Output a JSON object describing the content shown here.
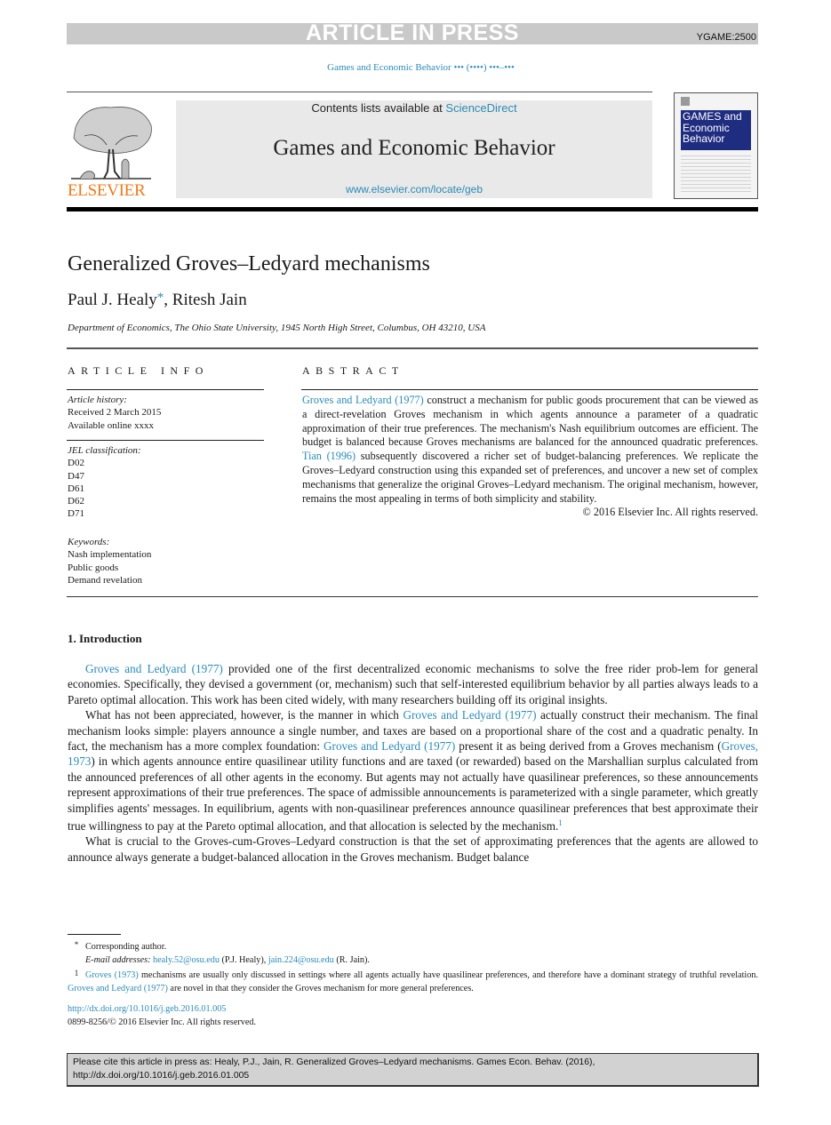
{
  "press_banner": {
    "label": "ARTICLE IN PRESS",
    "code": "YGAME:2500"
  },
  "journal_ref": "Games and Economic Behavior ••• (••••) •••–•••",
  "header": {
    "publisher_logo": "ELSEVIER",
    "contents_prefix": "Contents lists available at ",
    "contents_link": "ScienceDirect",
    "journal_name": "Games and Economic Behavior",
    "journal_url": "www.elsevier.com/locate/geb",
    "cover_title_lines": [
      "GAMES and",
      "Economic",
      "Behavior"
    ]
  },
  "article": {
    "title": "Generalized Groves–Ledyard mechanisms",
    "author1": "Paul J. Healy",
    "author_marker": "*",
    "author_sep": ", ",
    "author2": "Ritesh Jain",
    "affiliation": "Department of Economics, The Ohio State University, 1945 North High Street, Columbus, OH 43210, USA"
  },
  "article_info": {
    "heading": "ARTICLE INFO",
    "history_label": "Article history:",
    "received": "Received 2 March 2015",
    "available": "Available online xxxx",
    "jel_label": "JEL classification:",
    "jel_codes": [
      "D02",
      "D47",
      "D61",
      "D62",
      "D71"
    ],
    "keywords_label": "Keywords:",
    "keywords": [
      "Nash implementation",
      "Public goods",
      "Demand revelation"
    ]
  },
  "abstract": {
    "heading": "ABSTRACT",
    "link1": "Groves and Ledyard (1977)",
    "text1": " construct a mechanism for public goods procurement that can be viewed as a direct-revelation Groves mechanism in which agents announce a parameter of a quadratic approximation of their true preferences. The mechanism's Nash equilibrium outcomes are efficient. The budget is balanced because Groves mechanisms are balanced for the announced quadratic preferences. ",
    "link2": "Tian (1996)",
    "text2": " subsequently discovered a richer set of budget-balancing preferences. We replicate the Groves–Ledyard construction using this expanded set of preferences, and uncover a new set of complex mechanisms that generalize the original Groves–Ledyard mechanism. The original mechanism, however, remains the most appealing in terms of both simplicity and stability.",
    "copyright": "© 2016 Elsevier Inc. All rights reserved."
  },
  "introduction": {
    "heading": "1.  Introduction",
    "p1": {
      "link1": "Groves and Ledyard (1977)",
      "text1": " provided one of the first decentralized economic mechanisms to solve the free rider prob-lem for general economies. Specifically, they devised a government (or, mechanism) such that self-interested equilibrium behavior by all parties always leads to a Pareto optimal allocation. This work has been cited widely, with many researchers building off its original insights."
    },
    "p2": {
      "text1": "What has not been appreciated, however, is the manner in which ",
      "link1": "Groves and Ledyard (1977)",
      "text2": " actually construct their mechanism. The final mechanism looks simple: players announce a single number, and taxes are based on a proportional share of the cost and a quadratic penalty. In fact, the mechanism has a more complex foundation: ",
      "link2": "Groves and Ledyard (1977)",
      "text3": " present it as being derived from a Groves mechanism (",
      "link3": "Groves, 1973",
      "text4": ") in which agents announce entire quasilinear utility functions and are taxed (or rewarded) based on the Marshallian surplus calculated from the announced preferences of all other agents in the economy. But agents may not actually have quasilinear preferences, so these announcements represent approximations of their true preferences. The space of admissible announcements is parameterized with a single parameter, which greatly simplifies agents' messages. In equilibrium, agents with non-quasilinear preferences announce quasilinear preferences that best approximate their true willingness to pay at the Pareto optimal allocation, and that allocation is selected by the mechanism.",
      "footnote_ref": "1"
    },
    "p3": {
      "text1": "What is crucial to the Groves-cum-Groves–Ledyard construction is that the set of approximating preferences that the agents are allowed to announce always generate a budget-balanced allocation in the Groves mechanism. Budget balance"
    }
  },
  "footnotes": {
    "star_mark": "*",
    "corresponding": "Corresponding author.",
    "email_label": "E-mail addresses:",
    "email1": "healy.52@osu.edu",
    "email1_owner": " (P.J. Healy), ",
    "email2": "jain.224@osu.edu",
    "email2_owner": " (R. Jain).",
    "fn1_mark": "1",
    "fn1_link1": "Groves (1973)",
    "fn1_text1": " mechanisms are usually only discussed in settings where all agents actually have quasilinear preferences, and therefore have a dominant strategy of truthful revelation. ",
    "fn1_link2": "Groves and Ledyard (1977)",
    "fn1_text2": " are novel in that they consider the Groves mechanism for more general preferences."
  },
  "doi": {
    "link": "http://dx.doi.org/10.1016/j.geb.2016.01.005",
    "issn_line": "0899-8256/© 2016 Elsevier Inc. All rights reserved."
  },
  "cite_box": {
    "line1": "Please cite this article in press as: Healy, P.J., Jain, R. Generalized Groves–Ledyard mechanisms. Games Econ. Behav. (2016),",
    "line2": "http://dx.doi.org/10.1016/j.geb.2016.01.005"
  },
  "colors": {
    "link": "#2b8bb8",
    "elsevier_orange": "#f07a1c",
    "cover_blue": "#1f2d80",
    "banner_gray": "#c9c9c9"
  }
}
